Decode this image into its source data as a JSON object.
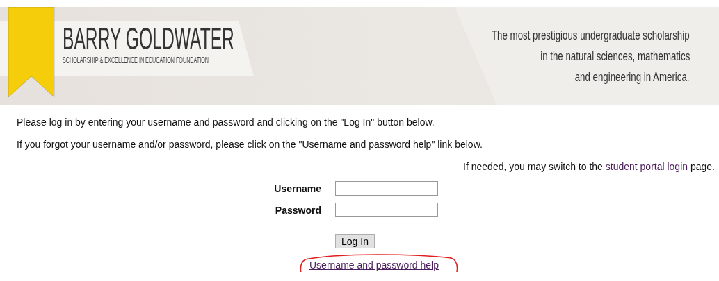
{
  "banner": {
    "title": "BARRY GOLDWATER",
    "subtitle": "SCHOLARSHIP & EXCELLENCE IN EDUCATION FOUNDATION",
    "tagline": [
      "The most prestigious undergraduate scholarship",
      "in the natural sciences, mathematics",
      "and engineering in America."
    ]
  },
  "instructions": [
    "Please log in by entering your username and password and clicking on the \"Log In\" button below.",
    "If you forgot your username and/or password, please click on the \"Username and password help\" link below."
  ],
  "portal_note": {
    "before": "If needed, you may switch to the",
    "link": "student portal login",
    "after": "page."
  },
  "form": {
    "fields": [
      {
        "label": "Username"
      },
      {
        "label": "Password"
      }
    ],
    "submit": "Log In",
    "help_link": "Username and password help"
  }
}
